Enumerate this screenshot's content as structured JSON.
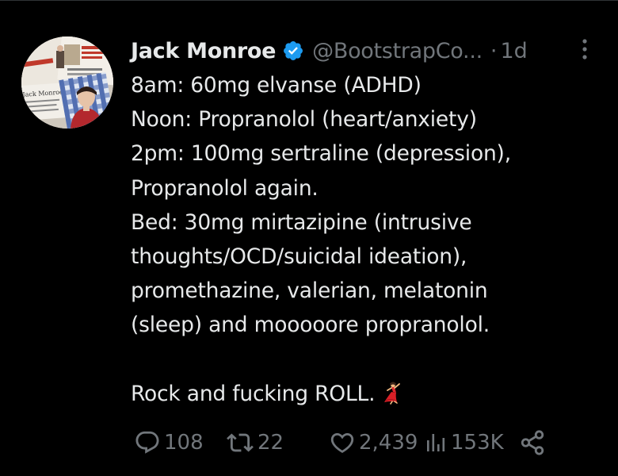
{
  "author": {
    "display_name": "Jack Monroe",
    "handle": "@BootstrapCo...",
    "separator": "·",
    "time_ago": "1d"
  },
  "colors": {
    "background": "#000000",
    "text_primary": "#e7e9ea",
    "text_secondary": "#71767b",
    "verified_blue": "#1d9bf0",
    "divider": "#2f3336"
  },
  "tweet": {
    "lines": [
      "8am: 60mg elvanse (ADHD)",
      "Noon: Propranolol (heart/anxiety)",
      "2pm: 100mg sertraline (depression),",
      "Propranolol again.",
      "Bed: 30mg mirtazipine (intrusive",
      "thoughts/OCD/suicidal ideation),",
      "promethazine, valerian, melatonin",
      "(sleep) and mooooore propranolol."
    ],
    "closing_line": "Rock and fucking ROLL.",
    "closing_emoji": "dancer-emoji"
  },
  "avatar": {
    "icon": "profile-photo-newspaper-collage",
    "newspaper_text": "Jack Monroe"
  },
  "actions": {
    "reply_count": "108",
    "retweet_count": "22",
    "like_count": "2,439",
    "view_count": "153K"
  }
}
